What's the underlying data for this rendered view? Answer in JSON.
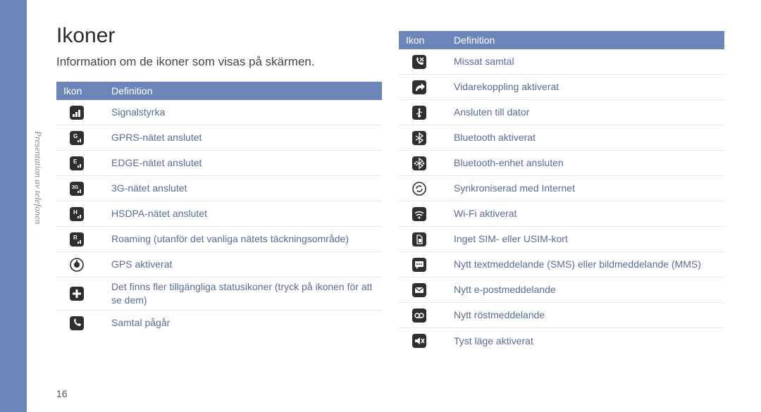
{
  "sidebar_label": "Presentation av telefonen",
  "title": "Ikoner",
  "subtitle": "Information om de ikoner som visas på skärmen.",
  "page_number": "16",
  "table_header": {
    "ikon": "Ikon",
    "def": "Definition"
  },
  "left_rows": [
    {
      "icon": "signal-icon",
      "def": "Signalstyrka"
    },
    {
      "icon": "gprs-icon",
      "def": "GPRS-nätet anslutet"
    },
    {
      "icon": "edge-icon",
      "def": "EDGE-nätet anslutet"
    },
    {
      "icon": "3g-icon",
      "def": "3G-nätet anslutet"
    },
    {
      "icon": "hsdpa-icon",
      "def": "HSDPA-nätet anslutet"
    },
    {
      "icon": "roaming-icon",
      "def": "Roaming (utanför det vanliga nätets täckningsområde)"
    },
    {
      "icon": "gps-icon",
      "def": "GPS aktiverat"
    },
    {
      "icon": "more-status-icon",
      "def": "Det finns fler tillgängliga statusikoner (tryck på ikonen för att se dem)"
    },
    {
      "icon": "call-active-icon",
      "def": "Samtal pågår"
    }
  ],
  "right_rows": [
    {
      "icon": "missed-call-icon",
      "def": "Missat samtal"
    },
    {
      "icon": "call-forward-icon",
      "def": "Vidarekoppling aktiverat"
    },
    {
      "icon": "usb-icon",
      "def": "Ansluten till dator"
    },
    {
      "icon": "bluetooth-icon",
      "def": "Bluetooth aktiverat"
    },
    {
      "icon": "bt-connected-icon",
      "def": "Bluetooth-enhet ansluten"
    },
    {
      "icon": "sync-icon",
      "def": "Synkroniserad med Internet"
    },
    {
      "icon": "wifi-icon",
      "def": "Wi-Fi aktiverat"
    },
    {
      "icon": "no-sim-icon",
      "def": "Inget SIM- eller USIM-kort"
    },
    {
      "icon": "sms-mms-icon",
      "def": "Nytt textmeddelande (SMS) eller bildmeddelande (MMS)"
    },
    {
      "icon": "email-icon",
      "def": "Nytt e-postmeddelande"
    },
    {
      "icon": "voicemail-icon",
      "def": "Nytt röstmeddelande"
    },
    {
      "icon": "silent-icon",
      "def": "Tyst läge aktiverat"
    }
  ]
}
